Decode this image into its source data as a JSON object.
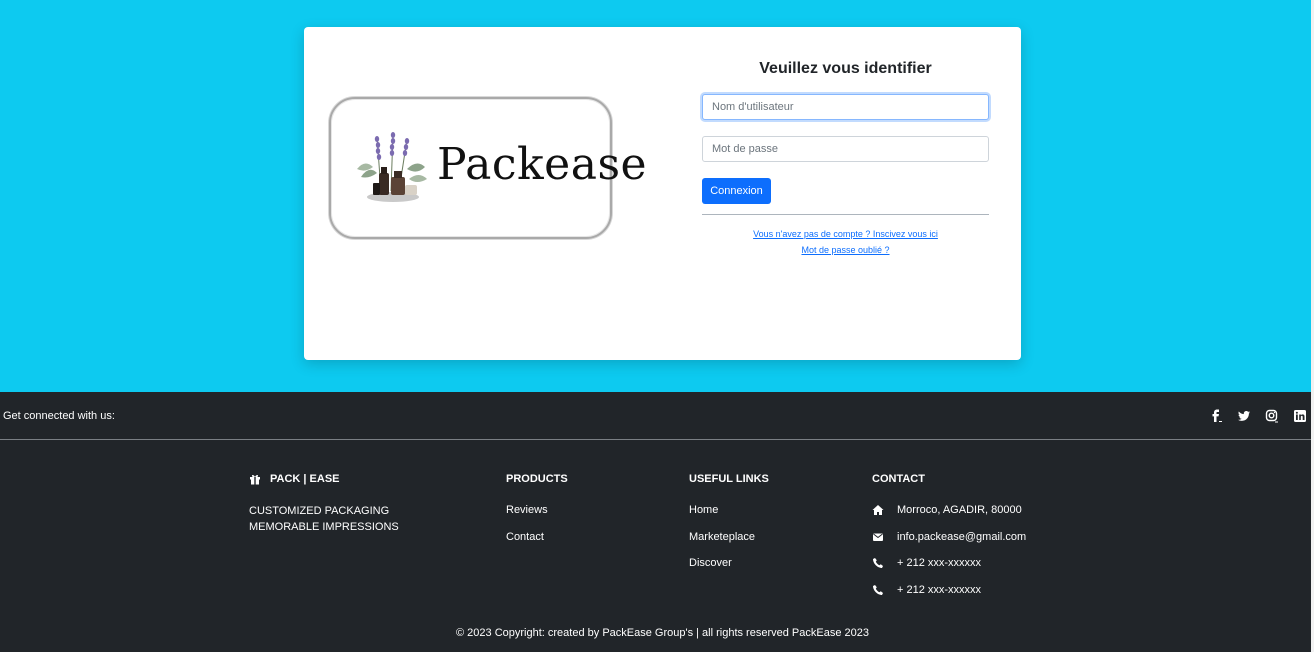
{
  "login": {
    "title": "Veuillez vous identifier",
    "username_placeholder": "Nom d'utilisateur",
    "password_placeholder": "Mot de passe",
    "submit_label": "Connexion",
    "signup_link": "Vous n'avez pas de compte ? Inscivez vous ici",
    "forgot_link": "Mot de passe oublié ?"
  },
  "logo": {
    "text": "Packease"
  },
  "social": {
    "text": "Get connected with us:",
    "icons": [
      "facebook-icon",
      "twitter-icon",
      "instagram-icon",
      "linkedin-icon"
    ]
  },
  "footer": {
    "brand": {
      "title": "PACK | EASE",
      "line1": "CUSTOMIZED PACKAGING",
      "line2": "MEMORABLE IMPRESSIONS"
    },
    "products": {
      "title": "PRODUCTS",
      "items": [
        "Reviews",
        "Contact"
      ]
    },
    "useful_links": {
      "title": "USEFUL LINKS",
      "items": [
        "Home",
        "Marketeplace",
        "Discover"
      ]
    },
    "contact": {
      "title": "CONTACT",
      "items": [
        {
          "icon": "home-icon",
          "text": "Morroco, AGADIR, 80000"
        },
        {
          "icon": "envelope-icon",
          "text": "info.packease@gmail.com"
        },
        {
          "icon": "phone-icon",
          "text": "+ 212 xxx-xxxxxx"
        },
        {
          "icon": "phone-icon",
          "text": "+ 212 xxx-xxxxxx"
        }
      ]
    },
    "copyright": "© 2023 Copyright: created by PackEase Group's | all rights reserved PackEase 2023"
  },
  "colors": {
    "background": "#0dcaf0",
    "footer": "#212529",
    "primary": "#0d6efd"
  }
}
